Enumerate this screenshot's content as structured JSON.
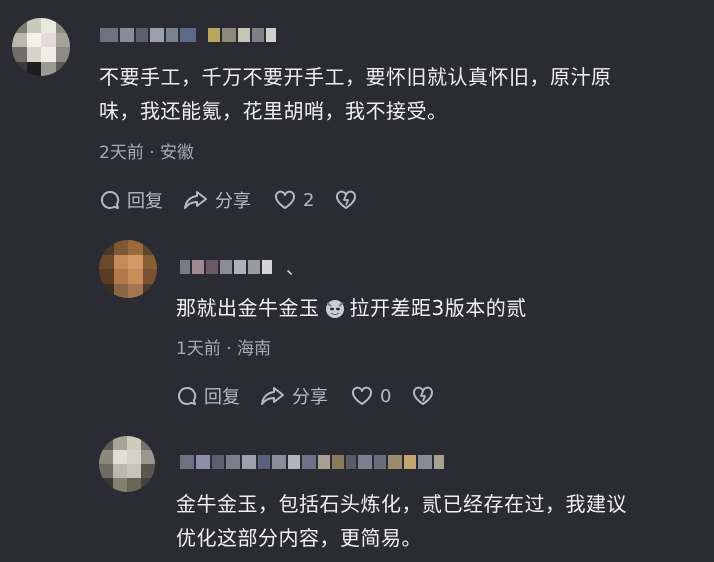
{
  "comments": [
    {
      "text_line1": "不要手工，千万不要开手工，要怀旧就认真怀旧，原汁原",
      "text_line2": "味，我还能氪，花里胡哨，我不接受。",
      "meta": "2天前 · 安徽",
      "reply_label": "回复",
      "share_label": "分享",
      "like_count": "2"
    },
    {
      "username_suffix": "、",
      "text_before": "那就出金牛金玉",
      "text_after": "拉开差距3版本的贰",
      "meta": "1天前 · 海南",
      "reply_label": "回复",
      "share_label": "分享",
      "like_count": "0"
    },
    {
      "text_line1": "金牛金玉，包括石头炼化，贰已经存在过，我建议",
      "text_line2": "优化这部分内容，更简易。"
    }
  ],
  "colors": {
    "background": "#2b2b33",
    "text": "#f0f0f4",
    "muted": "#a9a9b4"
  },
  "icons": [
    "reply-icon",
    "share-icon",
    "like-heart-icon",
    "dislike-broken-heart-icon",
    "wolf-emoji-icon"
  ]
}
